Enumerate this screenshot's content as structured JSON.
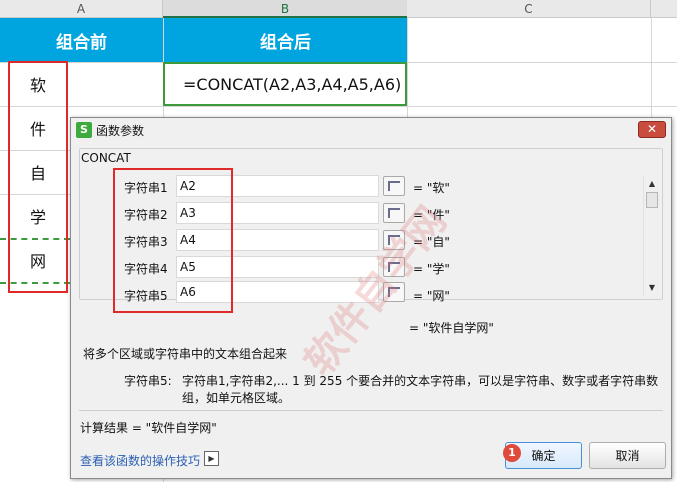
{
  "sheet": {
    "columns": [
      "A",
      "B",
      "C"
    ],
    "header_a": "组合前",
    "header_b": "组合后",
    "cells_a": [
      "软",
      "件",
      "自",
      "学",
      "网"
    ],
    "formula": "=CONCAT(A2,A3,A4,A5,A6)"
  },
  "dialog": {
    "title": "函数参数",
    "app_icon": "S",
    "close": "✕",
    "function_name": "CONCAT",
    "args": [
      {
        "label": "字符串1",
        "value": "A2",
        "result": "= \"软\""
      },
      {
        "label": "字符串2",
        "value": "A3",
        "result": "= \"件\""
      },
      {
        "label": "字符串3",
        "value": "A4",
        "result": "= \"自\""
      },
      {
        "label": "字符串4",
        "value": "A5",
        "result": "= \"学\""
      },
      {
        "label": "字符串5",
        "value": "A6",
        "result": "= \"网\""
      }
    ],
    "overall_result": "= \"软件自学网\"",
    "description": "将多个区域或字符串中的文本组合起来",
    "param_label": "字符串5:",
    "param_help_1": "字符串1,字符串2,... 1 到 255 个要合并的文本字符串，可以是字符串、数字或者字符串数",
    "param_help_2": "组，如单元格区域。",
    "calc_result": "计算结果 = \"软件自学网\"",
    "help_link": "查看该函数的操作技巧",
    "ok_label": "确定",
    "cancel_label": "取消",
    "badge": "1"
  },
  "watermark": "软件自学网"
}
